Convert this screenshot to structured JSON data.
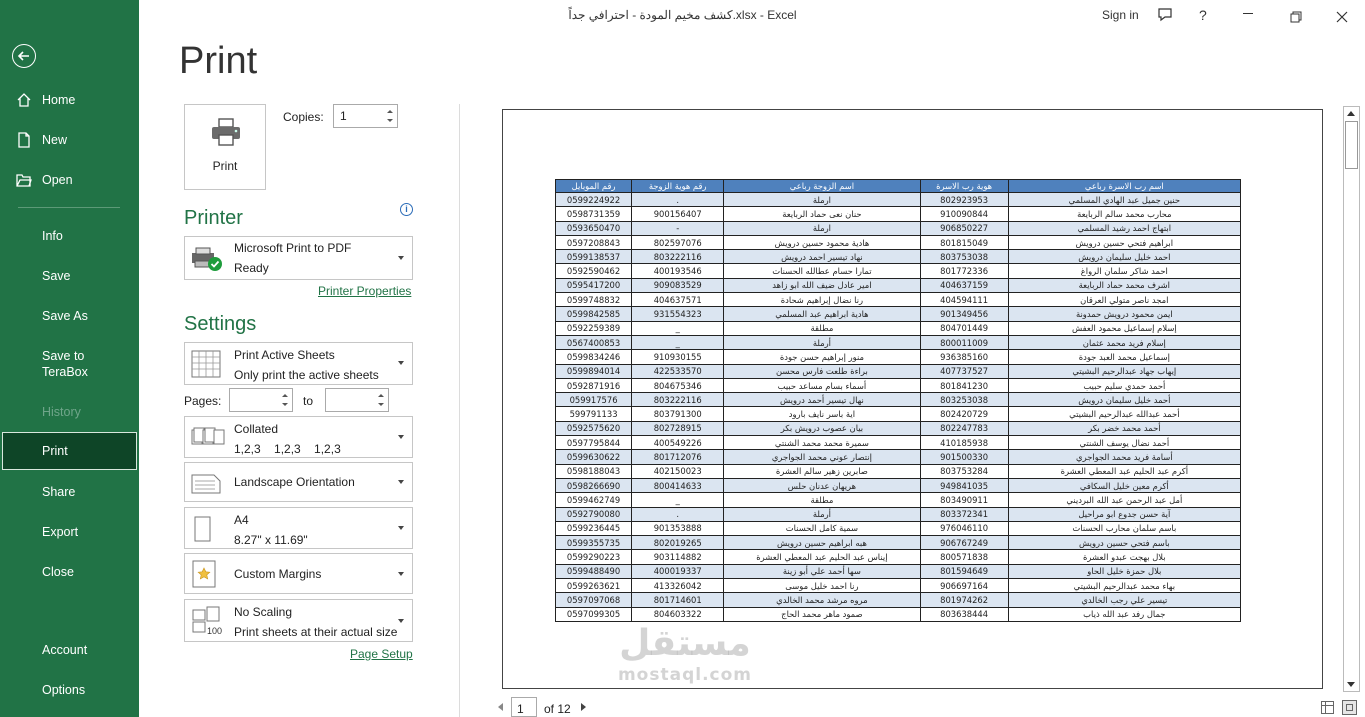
{
  "title_bar": {
    "filename": "كشف مخيم المودة - احترافي جداً.xlsx  -  Excel",
    "sign_in": "Sign in",
    "help": "?"
  },
  "nav": {
    "home": "Home",
    "new": "New",
    "open": "Open",
    "info": "Info",
    "save": "Save",
    "save_as": "Save As",
    "save_to_terabox": "Save to\nTeraBox",
    "history": "History",
    "print": "Print",
    "share": "Share",
    "export": "Export",
    "close": "Close",
    "account": "Account",
    "options": "Options"
  },
  "print": {
    "heading": "Print",
    "print_button": "Print",
    "copies_label": "Copies:",
    "copies_value": "1",
    "printer_heading": "Printer",
    "printer_name": "Microsoft Print to PDF",
    "printer_status": "Ready",
    "printer_properties": "Printer Properties",
    "settings_heading": "Settings",
    "what": {
      "title": "Print Active Sheets",
      "sub": "Only print the active sheets"
    },
    "pages_label": "Pages:",
    "to_label": "to",
    "collate": {
      "title": "Collated",
      "sub": "1,2,3    1,2,3    1,2,3"
    },
    "orientation": "Landscape Orientation",
    "paper": {
      "title": "A4",
      "sub": "8.27\" x 11.69\""
    },
    "margins": "Custom Margins",
    "scaling": {
      "title": "No Scaling",
      "sub": "Print sheets at their actual size"
    },
    "page_setup": "Page Setup"
  },
  "preview": {
    "page_current": "1",
    "page_total": "of 12",
    "watermark_ar": "مستقل",
    "watermark_en": "mostaql.com",
    "table": {
      "headers": [
        "اسم رب الاسرة رباعي",
        "هوية رب الاسرة",
        "اسم الزوجة رباعي",
        "رقم هوية الزوجة",
        "رقم الموبايل"
      ],
      "rows": [
        [
          "حنين جميل عبد الهادي المسلمي",
          "802923953",
          "ارملة",
          ".",
          "0599224922"
        ],
        [
          "محارب محمد سالم الربايعة",
          "910090844",
          "حنان نعى حماد الربايعة",
          "900156407",
          "0598731359"
        ],
        [
          "ابتهاج احمد رشيد المسلمي",
          "906850227",
          "ارملة",
          "-",
          "0593650470"
        ],
        [
          "ابراهيم فتحي حسين درويش",
          "801815049",
          "هادية محمود حسين درويش",
          "802597076",
          "0597208843"
        ],
        [
          "احمد خليل سليمان درويش",
          "803753038",
          "نهاد تيسير احمد درويش",
          "803222116",
          "0599138537"
        ],
        [
          "احمد شاكر سلمان الرواغ",
          "801772336",
          "تمارا حسام عطالله الحسنات",
          "400193546",
          "0592590462"
        ],
        [
          "اشرف محمد حماد الربايعة",
          "404637159",
          "امير عادل ضيف الله ابو زاهد",
          "909083529",
          "0595417200"
        ],
        [
          "امجد ناصر متولي العرقان",
          "404594111",
          "رنا نضال إبراهيم شحادة",
          "404637571",
          "0599748832"
        ],
        [
          "ايمن محمود درويش حمدونة",
          "901349456",
          "هادية ابراهيم عبد المسلمي",
          "931554323",
          "0599842585"
        ],
        [
          "إسلام إسماعيل محمود العفش",
          "804701449",
          "مطلقة",
          "_",
          "0592259389"
        ],
        [
          "إسلام فريد محمد عثمان",
          "800011009",
          "أرملة",
          "_",
          "0567400853"
        ],
        [
          "إسماعيل محمد العبد جودة",
          "936385160",
          "منور إبراهيم حسن جودة",
          "910930155",
          "0599834246"
        ],
        [
          "إيهاب جهاد عبدالرحيم البشيتي",
          "407737527",
          "براءة طلعت فارس محسن",
          "422533570",
          "0599894014"
        ],
        [
          "أحمد حمدي سليم حبيب",
          "801841230",
          "أسماء بسام مساعد حبيب",
          "804675346",
          "0592871916"
        ],
        [
          "أحمد خليل سليمان درويش",
          "803253038",
          "نهال تيسير أحمد درويش",
          "803222116",
          "059917576"
        ],
        [
          "أحمد عبدالله عبدالرحيم البشيتي",
          "802420729",
          "اية باسر نايف بارود",
          "803791300",
          "599791133"
        ],
        [
          "أحمد محمد خضر بكر",
          "802247783",
          "بيان عصوب درويش بكر",
          "802728915",
          "0592575620"
        ],
        [
          "أحمد نضال يوسف الشنتي",
          "410185938",
          "سميرة محمد محمد الشنتي",
          "400549226",
          "0597795844"
        ],
        [
          "أسامة فريد محمد الجواجري",
          "901500330",
          "إنتصار عوني محمد الجواجري",
          "801712076",
          "0599630622"
        ],
        [
          "أكرم عبد الحليم عبد المعطي العشرة",
          "803753284",
          "صابرين زهير سالم العشرة",
          "402150023",
          "0598188043"
        ],
        [
          "أكرم معين خليل السكافي",
          "949841035",
          "هريهان عدنان حلس",
          "800414633",
          "0598266690"
        ],
        [
          "أمل عبد الرحمن عبد الله البرديني",
          "803490911",
          "مطلقة",
          "_",
          "0599462749"
        ],
        [
          "آية حسن جدوع ابو مراحيل",
          "803372341",
          "أرملة",
          ".",
          "0592790080"
        ],
        [
          "باسم سلمان محارب الحسنات",
          "976046110",
          "سمية كامل الحسنات",
          "901353888",
          "0599236445"
        ],
        [
          "باسم فتحي حسين درويش",
          "906767249",
          "هبه ابراهيم حسين درويش",
          "802019265",
          "0599355735"
        ],
        [
          "بلال بهجت عبدو العشرة",
          "800571838",
          "إيناس عبد الحليم عبد المعطي العشرة",
          "903114882",
          "0599290223"
        ],
        [
          "بلال حمزة خليل الحاو",
          "801594649",
          "سها أحمد علي أبو زينة",
          "400019337",
          "0599488490"
        ],
        [
          "بهاء محمد عبدالرحيم البشيتي",
          "906697164",
          "رنا احمد خليل موسى",
          "413326042",
          "0599263621"
        ],
        [
          "تيسير علي رجب الخالدي",
          "801974262",
          "مروه مرشد محمد الخالدي",
          "801714601",
          "0597097068"
        ],
        [
          "جمال رفد عبد الله ذياب",
          "803638444",
          "صمود ماهر محمد الحاج",
          "804603322",
          "0597099305"
        ]
      ]
    }
  },
  "colors": {
    "accent": "#217346",
    "selected_nav": "#0e4527",
    "table_header": "#4f81bd",
    "table_alt_row": "#dbe5f1"
  }
}
